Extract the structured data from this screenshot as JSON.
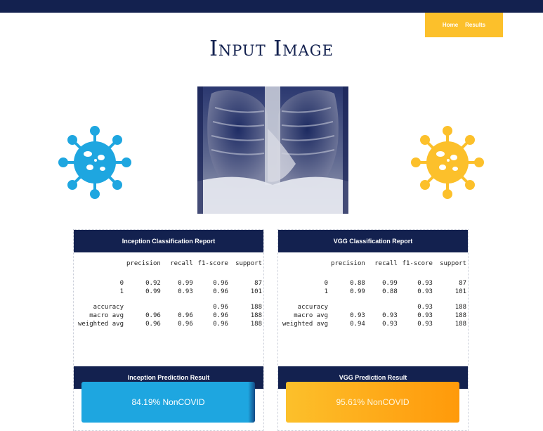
{
  "nav": {
    "items": [
      "Home",
      "Results"
    ]
  },
  "page": {
    "title": "Input Image"
  },
  "inception": {
    "report_title": "Inception Classification Report",
    "headers": [
      "",
      "precision",
      "recall",
      "f1-score",
      "support"
    ],
    "rows": [
      [
        "0",
        "0.92",
        "0.99",
        "0.96",
        "87"
      ],
      [
        "1",
        "0.99",
        "0.93",
        "0.96",
        "101"
      ]
    ],
    "summary": [
      [
        "accuracy",
        "",
        "",
        "0.96",
        "188"
      ],
      [
        "macro avg",
        "0.96",
        "0.96",
        "0.96",
        "188"
      ],
      [
        "weighted avg",
        "0.96",
        "0.96",
        "0.96",
        "188"
      ]
    ],
    "pred_title": "Inception Prediction Result",
    "pred_value": "84.19% NonCOVID"
  },
  "vgg": {
    "report_title": "VGG Classification Report",
    "headers": [
      "",
      "precision",
      "recall",
      "f1-score",
      "support"
    ],
    "rows": [
      [
        "0",
        "0.88",
        "0.99",
        "0.93",
        "87"
      ],
      [
        "1",
        "0.99",
        "0.88",
        "0.93",
        "101"
      ]
    ],
    "summary": [
      [
        "accuracy",
        "",
        "",
        "0.93",
        "188"
      ],
      [
        "macro avg",
        "0.93",
        "0.93",
        "0.93",
        "188"
      ],
      [
        "weighted avg",
        "0.94",
        "0.93",
        "0.93",
        "188"
      ]
    ],
    "pred_title": "VGG Prediction Result",
    "pred_value": "95.61% NonCOVID"
  },
  "colors": {
    "navy": "#13214f",
    "blue": "#1ea6e0",
    "yellow": "#fcc02b",
    "orange": "#ffa414"
  }
}
